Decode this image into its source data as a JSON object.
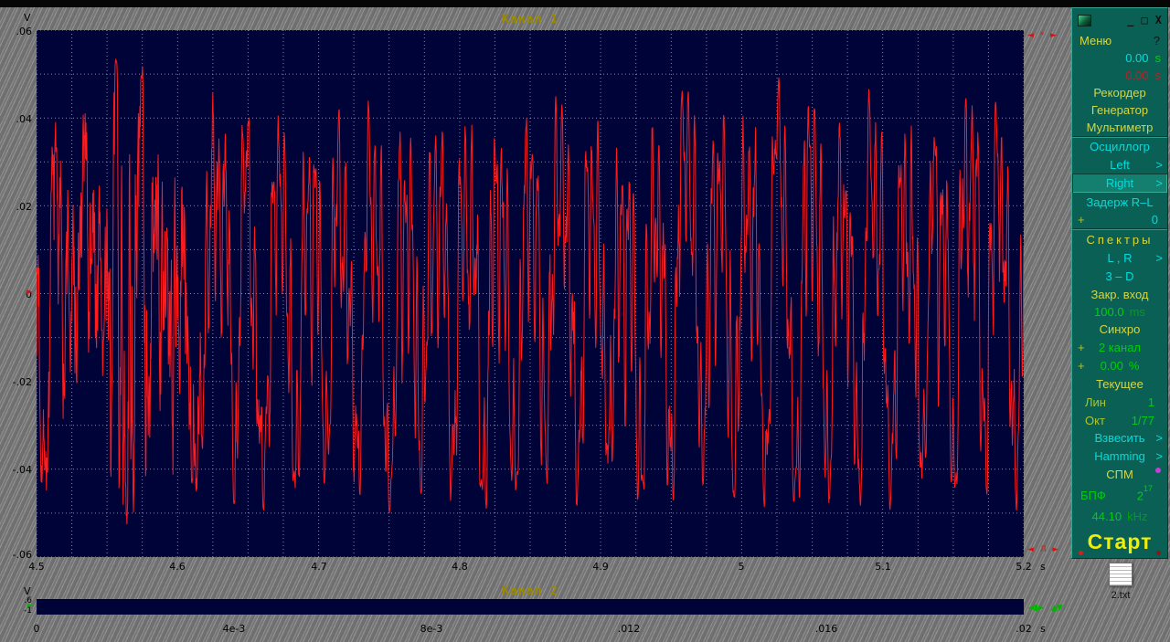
{
  "window": {
    "minimize": "_",
    "maximize": "□",
    "close": "X"
  },
  "channel1": {
    "title": "Канал 1",
    "y_unit": "V",
    "x_unit": "s",
    "y_ticks": [
      ".06",
      ".04",
      ".02",
      "0",
      "-.02",
      "-.04",
      "-.06"
    ],
    "x_ticks": [
      "4.5",
      "4.6",
      "4.7",
      "4.8",
      "4.9",
      "5",
      "5.1",
      "5.2"
    ],
    "markers": {
      "level_left": "►",
      "top_right": "◄ * ►",
      "bottom_right": "◄ Л ►"
    }
  },
  "channel2": {
    "title": "Канал 2",
    "y_unit": "V",
    "x_unit": "s",
    "y_ticks": [
      ".6",
      "-1"
    ],
    "x_ticks": [
      "0",
      "4e-3",
      "8e-3",
      ".012",
      ".016",
      ".02"
    ],
    "markers": {
      "left": "►",
      "right_a": "◄▮►",
      "right_b": "▲▼"
    }
  },
  "sidebar": {
    "menu": "Меню",
    "help": "?",
    "time_left": {
      "value": "0.00",
      "unit": "s"
    },
    "time_right": {
      "value": "0.00",
      "unit": "s"
    },
    "recorder": "Рекордер",
    "generator": "Генератор",
    "multimeter": "Мультиметр",
    "oscillograph": "Осциллогр",
    "left_btn": {
      "label": "Left",
      "arrow": ">"
    },
    "right_btn": {
      "label": "Right",
      "arrow": ">"
    },
    "delay_label": "Задерж R–L",
    "delay": {
      "plus": "+",
      "value": "0"
    },
    "spectra": "Спектры",
    "lr_btn": {
      "label": "L , R",
      "arrow": ">"
    },
    "three_d": "3 – D",
    "closed_input": "Закр. вход",
    "closed_input_time": {
      "value": "100.0",
      "unit": "ms"
    },
    "sync": "Синхро",
    "sync_source": {
      "plus": "+",
      "value": "2 канал"
    },
    "sync_level": {
      "plus": "+",
      "value": "0.00",
      "unit": "%"
    },
    "current": "Текущее",
    "lin": {
      "label": "Лин",
      "value": "1"
    },
    "oct": {
      "label": "Окт",
      "value": "1/77"
    },
    "weighting": {
      "label": "Взвесить",
      "arrow": ">"
    },
    "hamming": {
      "label": "Hamming",
      "arrow": ">"
    },
    "spm": "СПМ",
    "fft": {
      "label": "БПФ",
      "base": "2",
      "exp": "17"
    },
    "sample_rate": {
      "value": "44.10",
      "unit": "kHz"
    },
    "start": "Старт",
    "file_label": "2.txt"
  },
  "chart_data": [
    {
      "type": "line",
      "title": "Канал 1",
      "xlabel": "s",
      "ylabel": "V",
      "xlim": [
        4.5,
        5.2
      ],
      "ylim": [
        -0.06,
        0.06
      ],
      "x_major_step": 0.1,
      "x_minor_per_major": 4,
      "y_major_step": 0.02,
      "y_minor_per_major": 2,
      "grid": true,
      "legend": false,
      "bg": "#000338",
      "grid_color": "#9aa0c8",
      "series": [
        {
          "name": "Канал 1",
          "color": "#ff1c1c",
          "signal": {
            "kind": "quasi-periodic audio waveform, noisy burst at start",
            "fundamental_hz": 45,
            "peak_v": 0.047,
            "intro_noise_until_s": 4.615,
            "harmonics": [
              [
                1,
                0.55,
                0
              ],
              [
                2,
                0.22,
                1.3
              ],
              [
                5.2,
                0.3,
                0.5
              ],
              [
                9.7,
                0.16,
                2.1
              ]
            ],
            "samples": 2600,
            "seed": 7
          }
        }
      ]
    },
    {
      "type": "line",
      "title": "Канал 2",
      "xlabel": "s",
      "ylabel": "V",
      "xlim": [
        0,
        0.02
      ],
      "ylim": [
        -1,
        0.6
      ],
      "x_tick_labels": [
        "0",
        "4e-3",
        "8e-3",
        ".012",
        ".016",
        ".02"
      ],
      "y_tick_labels": [
        ".6",
        "-1"
      ],
      "series": []
    }
  ]
}
